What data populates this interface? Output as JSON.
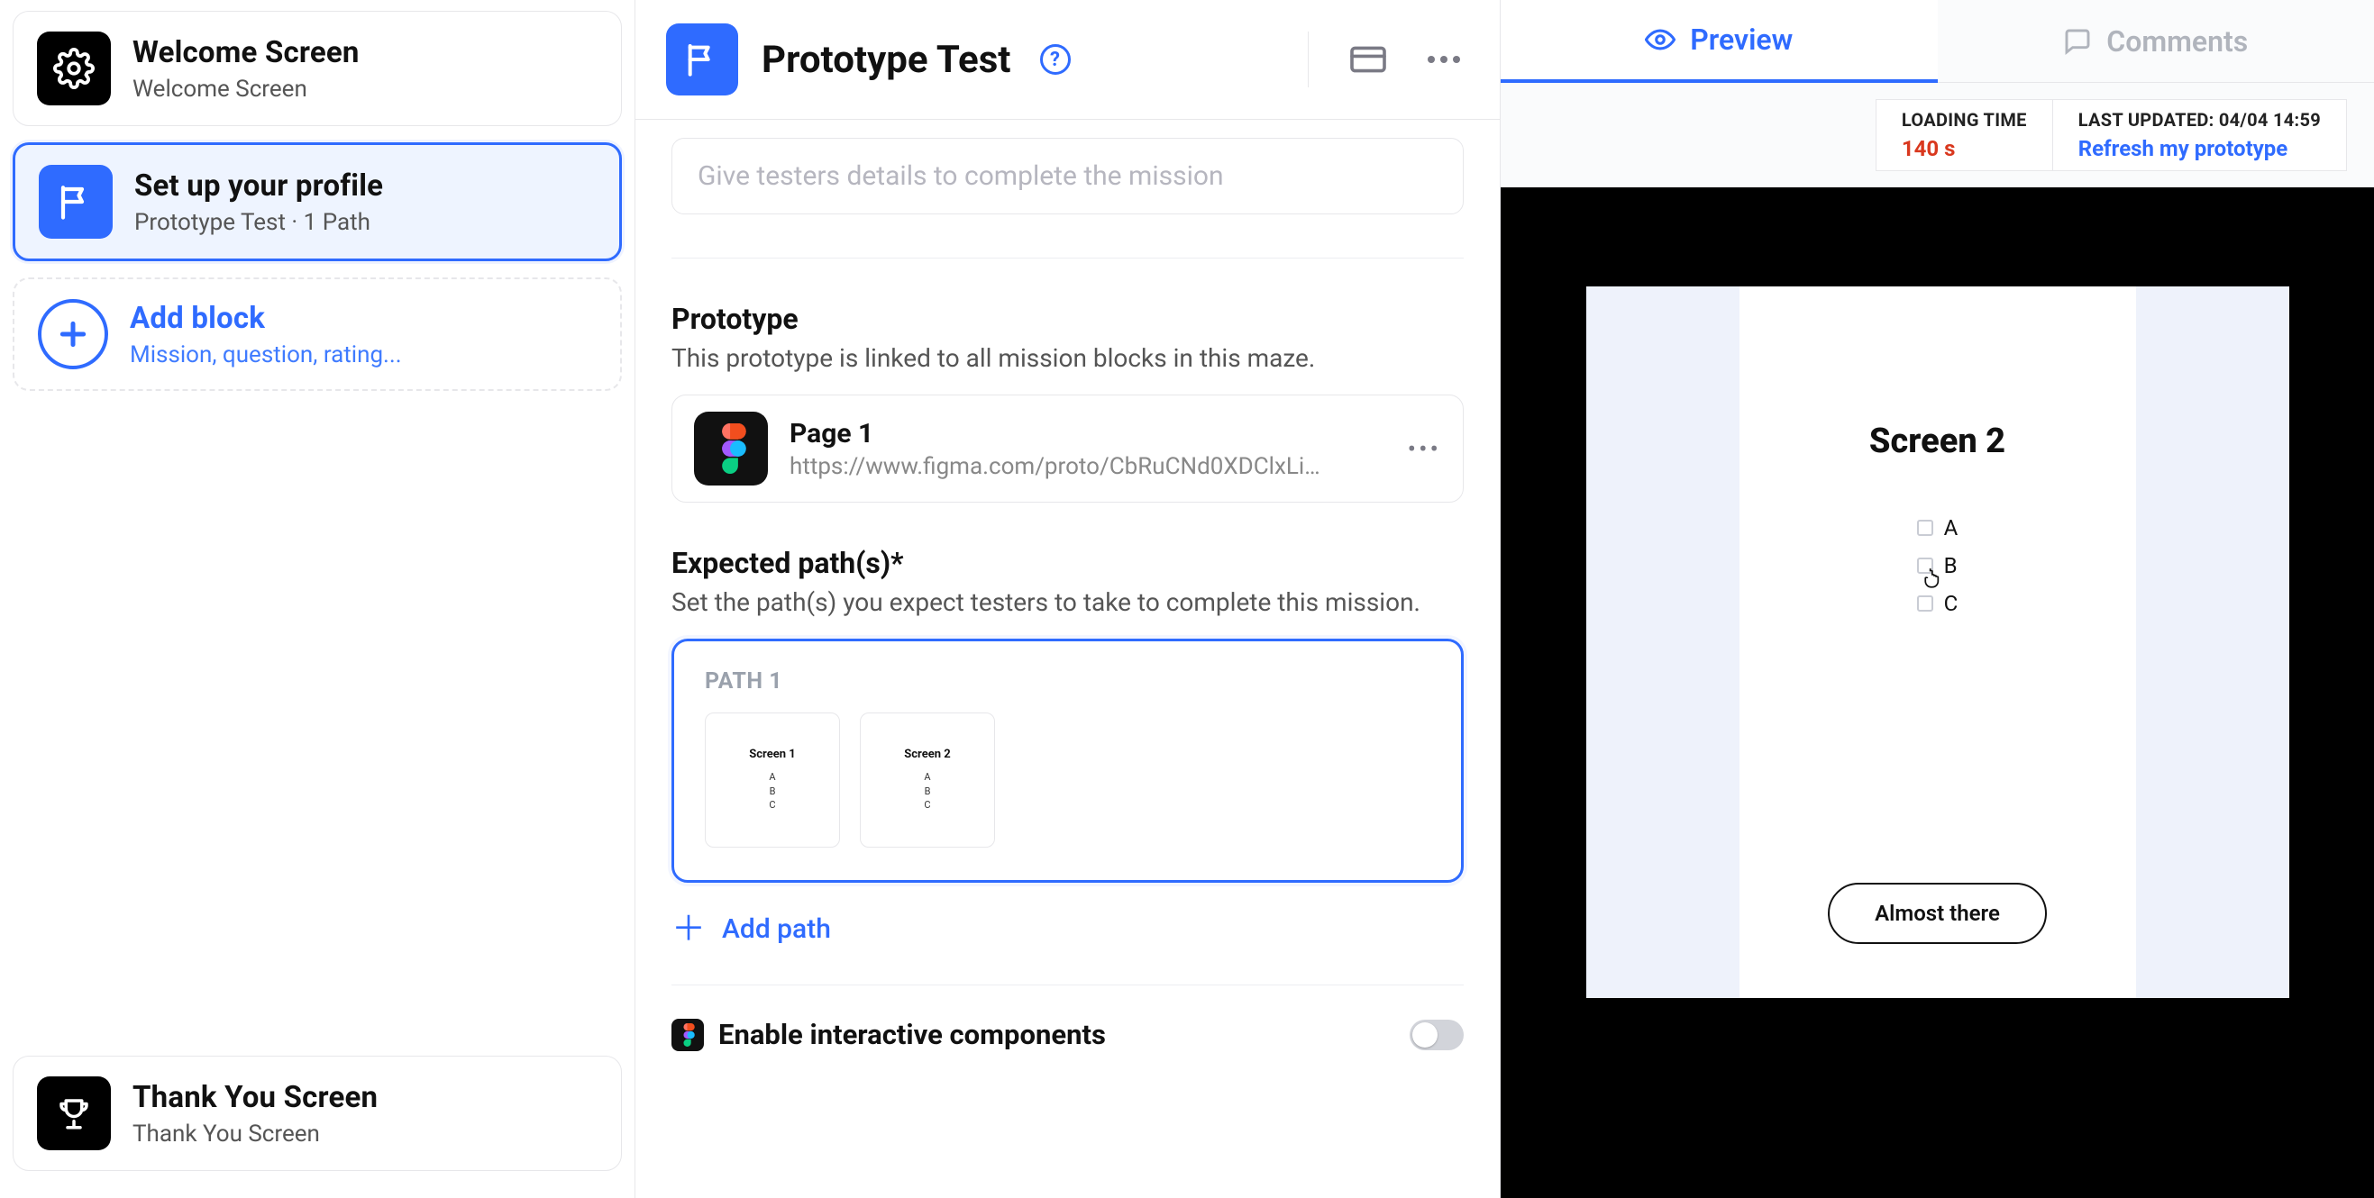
{
  "sidebar": {
    "welcome": {
      "title": "Welcome Screen",
      "subtitle": "Welcome Screen"
    },
    "profile": {
      "title": "Set up your profile",
      "subtitle": "Prototype Test · 1 Path"
    },
    "addblock": {
      "title": "Add block",
      "subtitle": "Mission, question, rating..."
    },
    "thankyou": {
      "title": "Thank You Screen",
      "subtitle": "Thank You Screen"
    }
  },
  "editor": {
    "title": "Prototype Test",
    "details_placeholder": "Give testers details to complete the mission",
    "proto_heading": "Prototype",
    "proto_sub": "This prototype is linked to all mission blocks in this maze.",
    "proto_name": "Page 1",
    "proto_url": "https://www.figma.com/proto/CbRuCNd0XDClxLipsA...",
    "paths_heading": "Expected path(s)*",
    "paths_sub": "Set the path(s) you expect testers to take to complete this mission.",
    "path_label": "PATH 1",
    "thumbs": [
      {
        "title": "Screen 1",
        "opts": [
          "A",
          "B",
          "C"
        ]
      },
      {
        "title": "Screen 2",
        "opts": [
          "A",
          "B",
          "C"
        ]
      }
    ],
    "add_path": "Add path",
    "toggle_label": "Enable interactive components"
  },
  "right": {
    "tab_preview": "Preview",
    "tab_comments": "Comments",
    "loading_label": "LOADING TIME",
    "loading_value": "140 s",
    "updated_label": "LAST UPDATED: 04/04 14:59",
    "refresh": "Refresh my prototype",
    "screen_title": "Screen 2",
    "options": [
      "A",
      "B",
      "C"
    ],
    "cta": "Almost there"
  }
}
